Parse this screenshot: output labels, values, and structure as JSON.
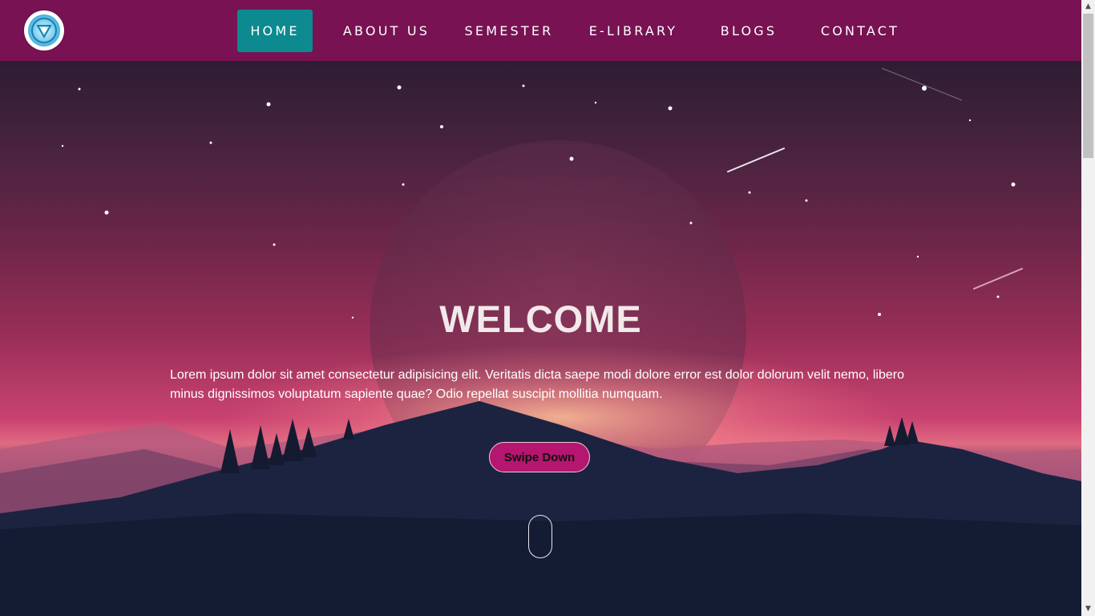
{
  "nav": {
    "logo_icon": "arc-reactor-logo",
    "items": [
      {
        "label": "HOME",
        "active": true
      },
      {
        "label": "ABOUT US",
        "active": false
      },
      {
        "label": "SEMESTER",
        "active": false
      },
      {
        "label": "E-LIBRARY",
        "active": false
      },
      {
        "label": "BLOGS",
        "active": false
      },
      {
        "label": "CONTACT",
        "active": false
      }
    ]
  },
  "hero": {
    "title": "WELCOME",
    "text": "Lorem ipsum dolor sit amet consectetur adipisicing elit. Veritatis dicta saepe modi dolore error est dolor dolorum velit nemo, libero minus dignissimos voluptatum sapiente quae? Odio repellat suscipit mollitia numquam.",
    "button_label": "Swipe Down",
    "scroll_indicator_icon": "mouse-scroll-icon"
  },
  "colors": {
    "navbar": "#781253",
    "active_nav": "#0c8a8f",
    "button": "#b5166f"
  },
  "scrollbar": {
    "up_icon": "scroll-up-arrow",
    "down_icon": "scroll-down-arrow"
  }
}
